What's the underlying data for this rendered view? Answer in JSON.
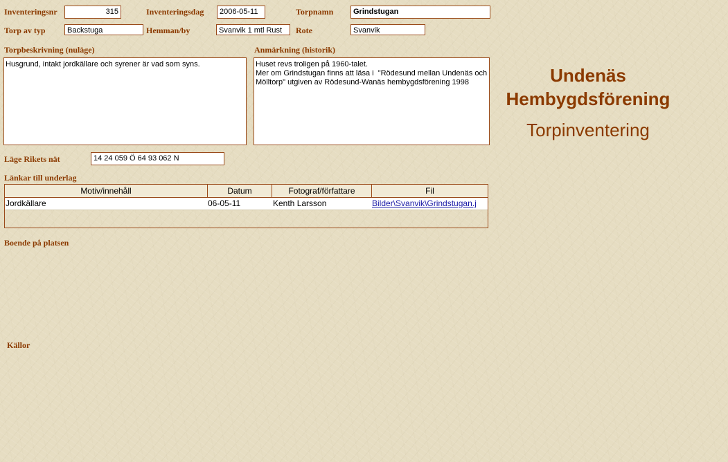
{
  "header": {
    "inventeringsnr_label": "Inventeringsnr",
    "inventeringsnr_value": "315",
    "inventeringsdag_label": "Inventeringsdag",
    "inventeringsdag_value": "2006-05-11",
    "torpnamn_label": "Torpnamn",
    "torpnamn_value": "Grindstugan",
    "torp_av_typ_label": "Torp av typ",
    "torp_av_typ_value": "Backstuga",
    "hemman_label": "Hemman/by",
    "hemman_value": "Svanvik 1 mtl Rust",
    "rote_label": "Rote",
    "rote_value": "Svanvik"
  },
  "descriptions": {
    "torpbeskrivning_label": "Torpbeskrivning (nuläge)",
    "torpbeskrivning_value": "Husgrund, intakt jordkällare och syrener är vad som syns.",
    "anmarkning_label": "Anmärkning (historik)",
    "anmarkning_value": "Huset revs troligen på 1960-talet.\nMer om Grindstugan finns att läsa i  \"Rödesund mellan Undenäs och Mölltorp\" utgiven av Rödesund-Wanäs hembygdsförening 1998"
  },
  "position": {
    "label": "Läge Rikets nät",
    "value": "14 24 059 Ö  64 93 062 N"
  },
  "links": {
    "label": "Länkar till underlag",
    "columns": [
      "Motiv/innehåll",
      "Datum",
      "Fotograf/författare",
      "Fil"
    ],
    "rows": [
      {
        "motiv": "Jordkällare",
        "datum": "06-05-11",
        "fotograf": "Kenth Larsson",
        "fil": "Bilder\\Svanvik\\Grindstugan.j"
      }
    ]
  },
  "boende_label": "Boende på platsen",
  "kallor_label": "Källor",
  "title": {
    "line1": "Undenäs",
    "line2": "Hembygdsförening",
    "subtitle": "Torpinventering"
  },
  "colors": {
    "label": "#8b3a00",
    "border": "#9a4a1a",
    "background": "#e6ddc2",
    "link": "#1a1aa6"
  }
}
